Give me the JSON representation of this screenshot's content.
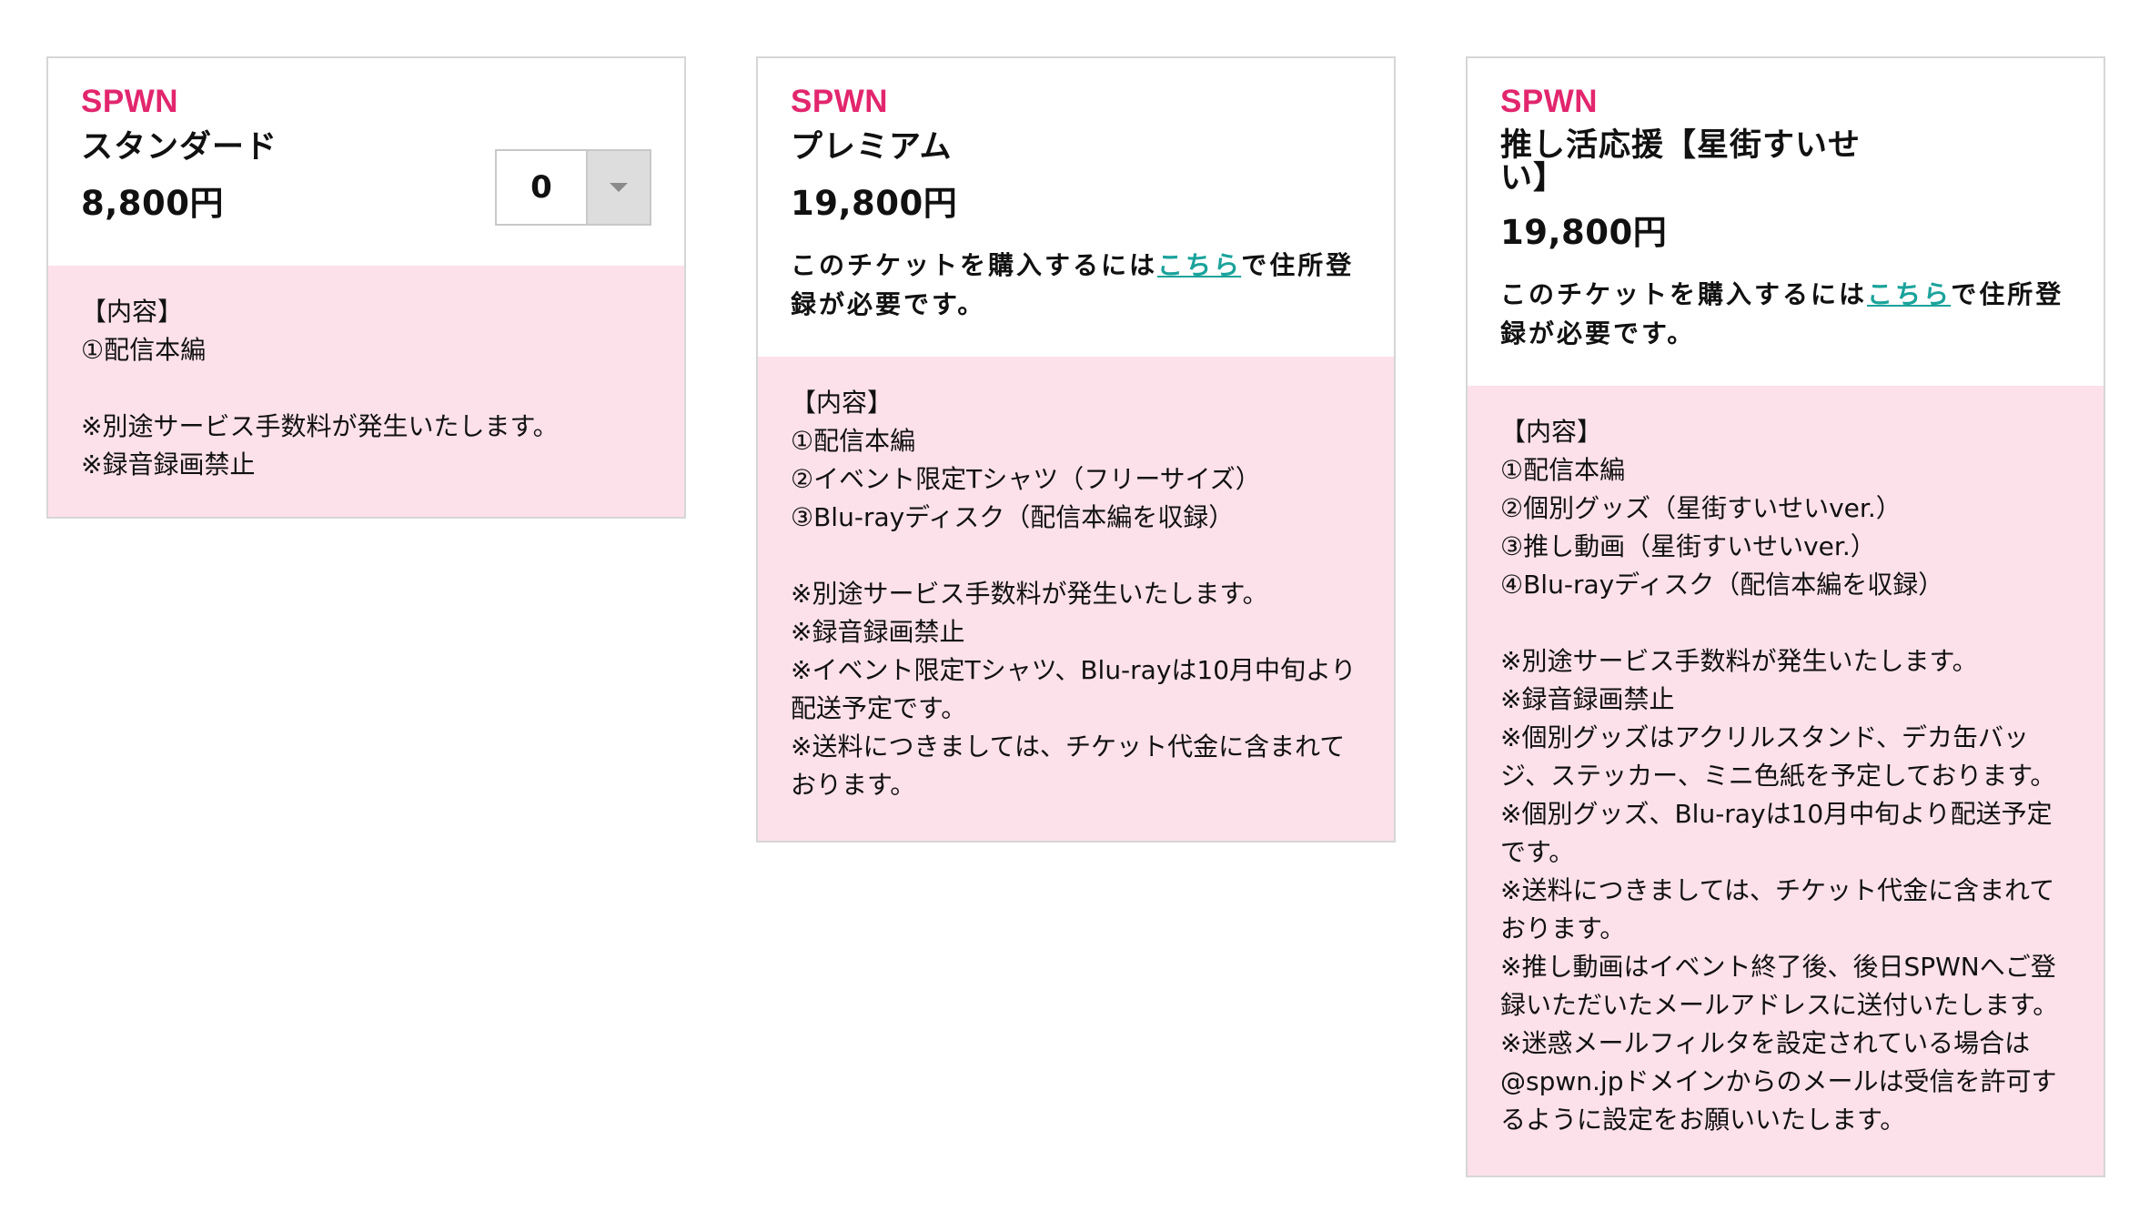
{
  "tickets": [
    {
      "brand": "SPWN",
      "name": "スタンダード",
      "price": "8,800円",
      "quantity": "0",
      "contents": [
        "【内容】",
        "①配信本編",
        "",
        "※別途サービス手数料が発生いたします。",
        "※録音録画禁止"
      ]
    },
    {
      "brand": "SPWN",
      "name": "プレミアム",
      "price": "19,800円",
      "notice_prefix": "このチケットを購入するには",
      "notice_link": "こちら",
      "notice_suffix": "で住所登録が必要です。",
      "contents": [
        "【内容】",
        "①配信本編",
        "②イベント限定Tシャツ（フリーサイズ）",
        "③Blu-rayディスク（配信本編を収録）",
        "",
        "※別途サービス手数料が発生いたします。",
        "※録音録画禁止",
        "※イベント限定Tシャツ、Blu-rayは10月中旬より配送予定です。",
        "※送料につきましては、チケット代金に含まれております。"
      ]
    },
    {
      "brand": "SPWN",
      "name": "推し活応援【星街すいせい】",
      "price": "19,800円",
      "notice_prefix": "このチケットを購入するには",
      "notice_link": "こちら",
      "notice_suffix": "で住所登録が必要です。",
      "contents": [
        "【内容】",
        "①配信本編",
        "②個別グッズ（星街すいせいver.）",
        "③推し動画（星街すいせいver.）",
        "④Blu-rayディスク（配信本編を収録）",
        "",
        "※別途サービス手数料が発生いたします。",
        "※録音録画禁止",
        "※個別グッズはアクリルスタンド、デカ缶バッジ、ステッカー、ミニ色紙を予定しております。",
        "※個別グッズ、Blu-rayは10月中旬より配送予定です。",
        "※送料につきましては、チケット代金に含まれております。",
        "※推し動画はイベント終了後、後日SPWNへご登録いただいたメールアドレスに送付いたします。",
        "※迷惑メールフィルタを設定されている場合は@spwn.jpドメインからのメールは受信を許可するように設定をお願いいたします。"
      ]
    }
  ],
  "colors": {
    "brand": "#e2266e",
    "link": "#1aa39b",
    "content_bg": "#fde1ea",
    "border": "#d6d6d6"
  }
}
